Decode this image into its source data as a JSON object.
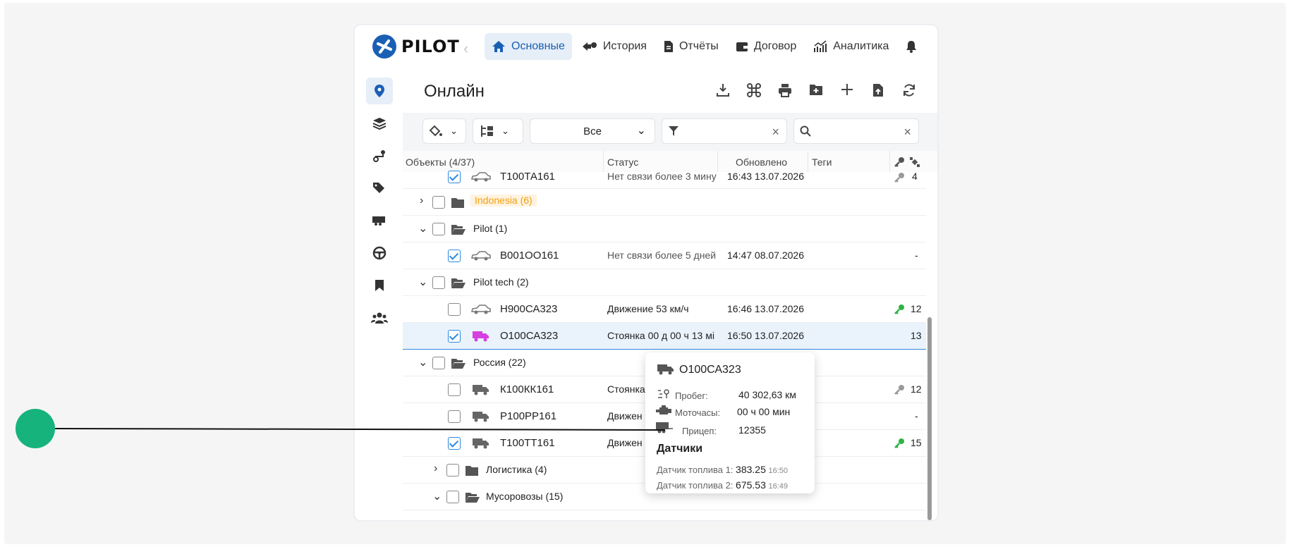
{
  "app": {
    "logo_text": "PILOT",
    "nav": [
      {
        "label": "Основные"
      },
      {
        "label": "История"
      },
      {
        "label": "Отчёты"
      },
      {
        "label": "Договор"
      },
      {
        "label": "Аналитика"
      }
    ]
  },
  "page": {
    "title": "Онлайн",
    "filter_select_value": "Все",
    "filter_input_value": "",
    "search_input_value": ""
  },
  "table": {
    "headers": {
      "objects": "Объекты (4/37)",
      "status": "Статус",
      "updated": "Обновлено",
      "tags": "Теги"
    },
    "rows": [
      {
        "name": "Т100ТА161",
        "status": "Нет связи более 3 мину",
        "updated": "16:43 13.07.2026",
        "extra": "4"
      },
      {
        "group": "Indonesia (6)"
      },
      {
        "group": "Pilot (1)"
      },
      {
        "name": "В001ОО161",
        "status": "Нет связи более 5 дней",
        "updated": "14:47 08.07.2026",
        "extra": "-"
      },
      {
        "group": "Pilot tech (2)"
      },
      {
        "name": "Н900СА323",
        "status": "Движение 53 км/ч",
        "updated": "16:46 13.07.2026",
        "extra": "12"
      },
      {
        "name": "О100СА323",
        "status": "Стоянка 00 д 00 ч 13 мі",
        "updated": "16:50 13.07.2026",
        "extra": "13"
      },
      {
        "group": "Россия (22)"
      },
      {
        "name": "К100КК161",
        "status": "Стоянка",
        "extra": "12"
      },
      {
        "name": "Р100РР161",
        "status": "Движен",
        "extra": "-"
      },
      {
        "name": "Т100ТТ161",
        "status": "Движен",
        "extra": "15"
      },
      {
        "group": "Логистика (4)"
      },
      {
        "group": "Мусоровозы (15)"
      }
    ]
  },
  "popup": {
    "title": "О100СА323",
    "mileage_label": "Пробег:",
    "mileage_value": "40 302,63 км",
    "engine_label": "Моточасы:",
    "engine_value": "00 ч 00 мин",
    "trailer_label": "Прицеп:",
    "trailer_value": "12355",
    "sensors_title": "Датчики",
    "sensors": [
      {
        "label": "Датчик топлива 1:",
        "value": "383.25",
        "time": "16:50"
      },
      {
        "label": "Датчик топлива 2:",
        "value": "675.53",
        "time": "16:49"
      }
    ]
  },
  "colors": {
    "accent": "#1a5fb4",
    "selection_border": "#2d8ae0",
    "key_green": "#2fb344",
    "truck_purple": "#d63fe0",
    "group_tag": "#f0a010",
    "pointer": "#16b37d"
  }
}
